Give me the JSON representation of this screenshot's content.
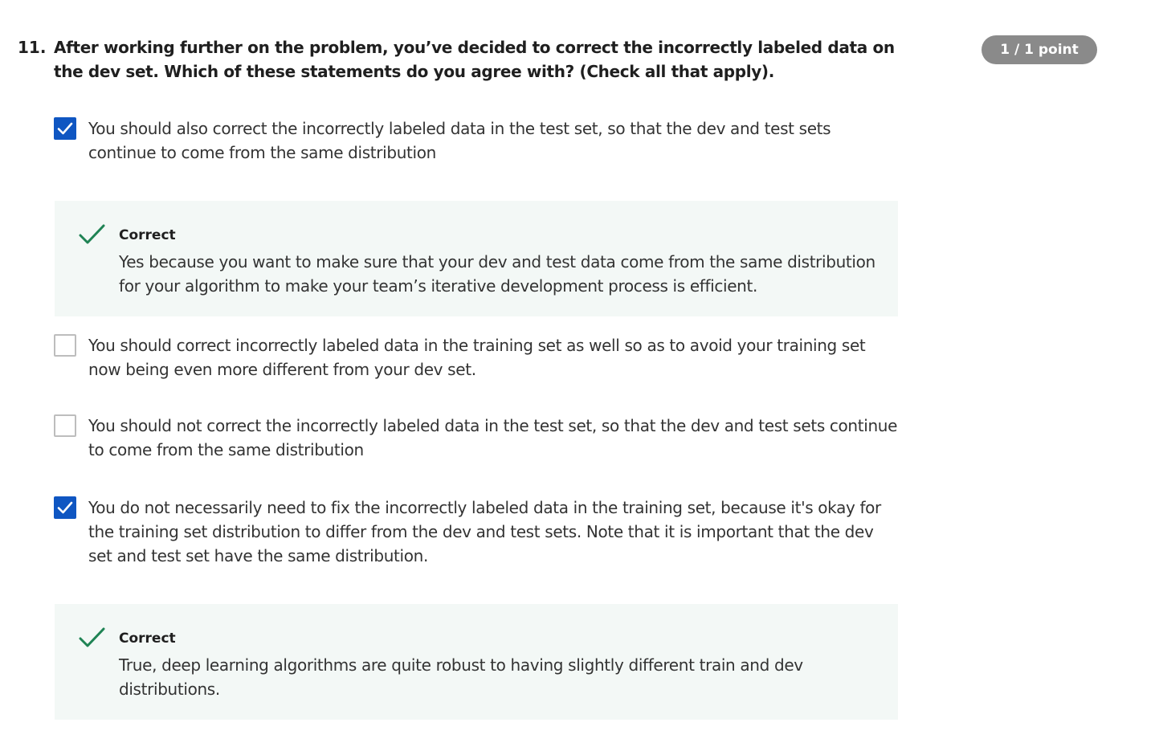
{
  "question": {
    "number": "11.",
    "text": "After working further on the problem, you’ve decided to correct the incorrectly labeled data on the dev set. Which of these statements do you agree with? (Check all that apply).",
    "score": "1 / 1 point"
  },
  "options": [
    {
      "text": "You should also correct the incorrectly labeled data in the test set, so that the dev and test sets continue to come from the same distribution",
      "checked": true,
      "feedback": {
        "title": "Correct",
        "text": "Yes because you want to make sure that your dev and test data come from the same distribution for your algorithm to make your team’s iterative development process is efficient."
      }
    },
    {
      "text": "You should correct incorrectly labeled data in the training set as well so as to avoid your training set now being even more different from your dev set.",
      "checked": false
    },
    {
      "text": "You should not correct the incorrectly labeled data in the test set, so that the dev and test sets continue to come from the same distribution",
      "checked": false
    },
    {
      "text": "You do not necessarily need to fix the incorrectly labeled data in the training set, because it's okay for the training set distribution to differ from the dev and test sets. Note that it is important that the dev set and test set have the same distribution.",
      "checked": true,
      "feedback": {
        "title": "Correct",
        "text": "True, deep learning algorithms are quite robust to having slightly different train and dev distributions."
      }
    }
  ],
  "colors": {
    "checkbox_checked": "#0f56c2",
    "checkmark_correct": "#1f8354",
    "feedback_background": "#f3f8f6",
    "score_badge": "#8a8a8a"
  }
}
